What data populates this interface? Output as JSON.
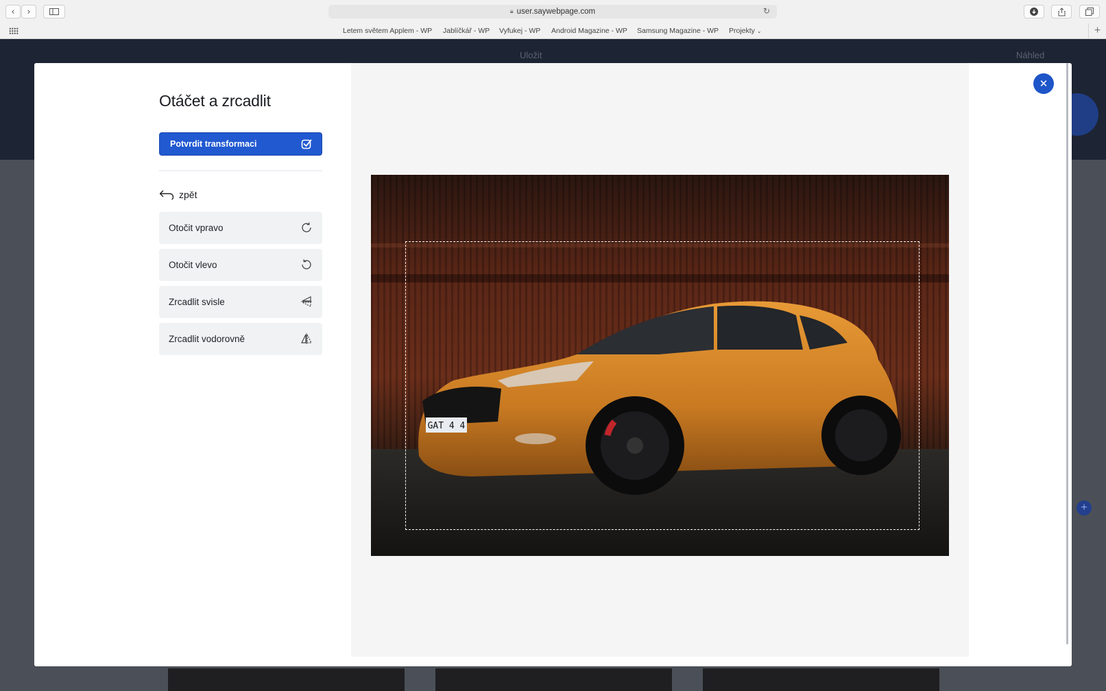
{
  "browser": {
    "url": "user.saywebpage.com",
    "bookmarks": [
      "Letem světem Applem - WP",
      "Jablíčkář - WP",
      "Vyfukej - WP",
      "Android Magazine - WP",
      "Samsung Magazine - WP",
      "Projekty"
    ]
  },
  "background_page": {
    "save_label": "Uložit",
    "preview_label": "Náhled"
  },
  "modal": {
    "title": "Otáčet a zrcadlit",
    "confirm_label": "Potvrdit transformaci",
    "back_label": "zpět",
    "actions": [
      {
        "label": "Otočit vpravo",
        "icon": "rotate-right-icon"
      },
      {
        "label": "Otočit vlevo",
        "icon": "rotate-left-icon"
      },
      {
        "label": "Zrcadlit svisle",
        "icon": "flip-vertical-icon"
      },
      {
        "label": "Zrcadlit vodorovně",
        "icon": "flip-horizontal-icon"
      }
    ],
    "accent_color": "#2159d1",
    "image_plate_text": "GAT 4 4"
  }
}
